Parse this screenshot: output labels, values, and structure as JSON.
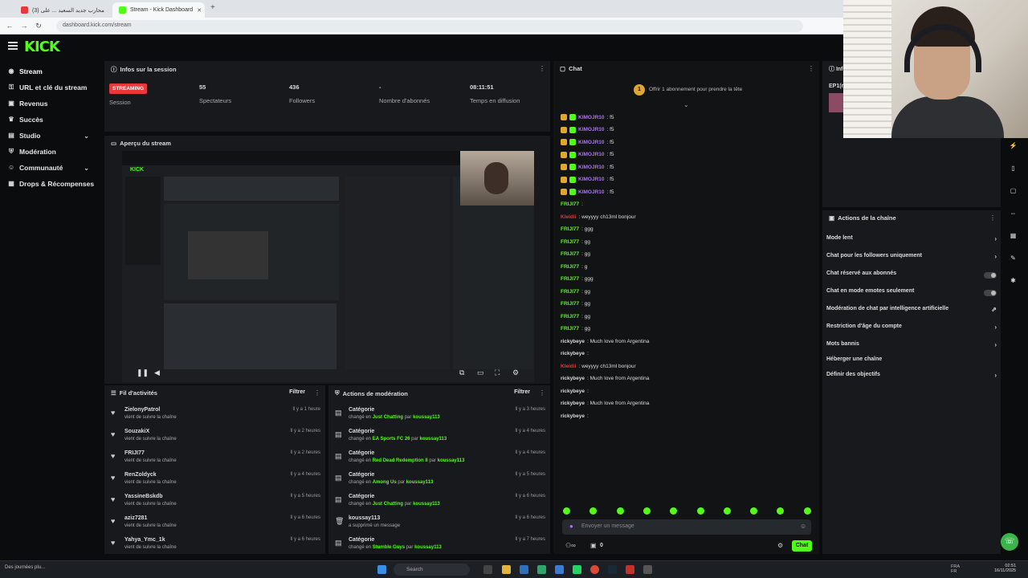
{
  "browser": {
    "tabs": [
      {
        "label": "(3) محارب جديد السعيد ... على",
        "active": false
      },
      {
        "label": "Stream - Kick Dashboard",
        "active": true
      }
    ],
    "new_tab": "+",
    "url": "dashboard.kick.com/stream"
  },
  "header": {
    "logo": "KICK"
  },
  "sidebar": {
    "items": [
      {
        "label": "Stream",
        "icon": "broadcast-icon",
        "chevron": false
      },
      {
        "label": "URL et clé du stream",
        "icon": "key-icon",
        "chevron": false
      },
      {
        "label": "Revenus",
        "icon": "money-icon",
        "chevron": false
      },
      {
        "label": "Succès",
        "icon": "trophy-icon",
        "chevron": false
      },
      {
        "label": "Studio",
        "icon": "studio-icon",
        "chevron": true
      },
      {
        "label": "Modération",
        "icon": "shield-icon",
        "chevron": false
      },
      {
        "label": "Communauté",
        "icon": "community-icon",
        "chevron": true
      },
      {
        "label": "Drops & Récompenses",
        "icon": "gift-icon",
        "chevron": false
      }
    ]
  },
  "session": {
    "title": "Infos sur la session",
    "stats": [
      {
        "value": "STREAMING",
        "label": "Session"
      },
      {
        "value": "55",
        "label": "Spectateurs"
      },
      {
        "value": "436",
        "label": "Followers"
      },
      {
        "value": "-",
        "label": "Nombre d'abonnés"
      },
      {
        "value": "08:11:51",
        "label": "Temps en diffusion"
      }
    ]
  },
  "preview": {
    "title": "Aperçu du stream"
  },
  "activity": {
    "title": "Fil d'activités",
    "filter": "Filtrer",
    "items": [
      {
        "name": "ZielonyPatrol",
        "sub": "vient de suivre la chaîne",
        "time": "Il y a 1 heure"
      },
      {
        "name": "SouzakiX",
        "sub": "vient de suivre la chaîne",
        "time": "Il y a 2 heures"
      },
      {
        "name": "FRIJI77",
        "sub": "vient de suivre la chaîne",
        "time": "Il y a 2 heures"
      },
      {
        "name": "RenZoldyck",
        "sub": "vient de suivre la chaîne",
        "time": "Il y a 4 heures"
      },
      {
        "name": "YassineBskdb",
        "sub": "vient de suivre la chaîne",
        "time": "Il y a 5 heures"
      },
      {
        "name": "aziz7281",
        "sub": "vient de suivre la chaîne",
        "time": "Il y a 6 heures"
      },
      {
        "name": "Yahya_Ymc_1k",
        "sub": "vient de suivre la chaîne",
        "time": "Il y a 6 heures"
      }
    ]
  },
  "moderation": {
    "title": "Actions de modération",
    "filter": "Filtrer",
    "items": [
      {
        "name": "Catégorie",
        "pre": "changé en",
        "value": "Just Chatting",
        "mid": "par",
        "by": "koussay113",
        "time": "Il y a 3 heures"
      },
      {
        "name": "Catégorie",
        "pre": "changé en",
        "value": "EA Sports FC 26",
        "mid": "par",
        "by": "koussay113",
        "time": "Il y a 4 heures"
      },
      {
        "name": "Catégorie",
        "pre": "changé en",
        "value": "Red Dead Redemption II",
        "mid": "par",
        "by": "koussay113",
        "time": "Il y a 4 heures"
      },
      {
        "name": "Catégorie",
        "pre": "changé en",
        "value": "Among Us",
        "mid": "par",
        "by": "koussay113",
        "time": "Il y a 5 heures"
      },
      {
        "name": "Catégorie",
        "pre": "changé en",
        "value": "Just Chatting",
        "mid": "par",
        "by": "koussay113",
        "time": "Il y a 6 heures"
      },
      {
        "name": "koussay113",
        "pre": "a supprimé un message",
        "value": "",
        "mid": "",
        "by": "",
        "time": "Il y a 6 heures"
      },
      {
        "name": "Catégorie",
        "pre": "changé en",
        "value": "Stumble Guys",
        "mid": "par",
        "by": "koussay113",
        "time": "Il y a 7 heures"
      }
    ]
  },
  "chat": {
    "title": "Chat",
    "pinned": "Offrir 1 abonnement pour prendre la tête",
    "messages": [
      {
        "user": "KIMOJR10",
        "text": ": f5",
        "color": "#b46bff"
      },
      {
        "user": "KIMOJR10",
        "text": ": f5",
        "color": "#b46bff"
      },
      {
        "user": "KIMOJR10",
        "text": ": f5",
        "color": "#b46bff"
      },
      {
        "user": "KIMOJR10",
        "text": ": f5",
        "color": "#b46bff"
      },
      {
        "user": "KIMOJR10",
        "text": ": f5",
        "color": "#b46bff"
      },
      {
        "user": "KIMOJR10",
        "text": ": f5",
        "color": "#b46bff"
      },
      {
        "user": "KIMOJR10",
        "text": ": f5",
        "color": "#b46bff"
      },
      {
        "user": "FRIJI77",
        "text": ":",
        "color": "#53fc18"
      },
      {
        "user": "Kleidii",
        "text": ": weyyyy ch13ml bonjour",
        "color": "#e5393b"
      },
      {
        "user": "FRIJI77",
        "text": ": ggg",
        "color": "#53fc18"
      },
      {
        "user": "FRIJI77",
        "text": ": gg",
        "color": "#53fc18"
      },
      {
        "user": "FRIJI77",
        "text": ": gg",
        "color": "#53fc18"
      },
      {
        "user": "FRIJI77",
        "text": ": g",
        "color": "#53fc18"
      },
      {
        "user": "FRIJI77",
        "text": ": ggg",
        "color": "#53fc18"
      },
      {
        "user": "FRIJI77",
        "text": ": gg",
        "color": "#53fc18"
      },
      {
        "user": "FRIJI77",
        "text": ": gg",
        "color": "#53fc18"
      },
      {
        "user": "FRIJI77",
        "text": ": gg",
        "color": "#53fc18"
      },
      {
        "user": "FRIJI77",
        "text": ": gg",
        "color": "#53fc18"
      },
      {
        "user": "rickybeye",
        "text": ": Much love from Argentina",
        "color": "#dddddd"
      },
      {
        "user": "rickybeye",
        "text": ": ",
        "color": "#dddddd"
      },
      {
        "user": "Kleidii",
        "text": ": weyyyy ch13ml bonjour",
        "color": "#e5393b"
      },
      {
        "user": "rickybeye",
        "text": ": Much love from Argentina",
        "color": "#dddddd"
      },
      {
        "user": "rickybeye",
        "text": ": ",
        "color": "#dddddd"
      },
      {
        "user": "rickybeye",
        "text": ": Much love from Argentina",
        "color": "#dddddd"
      },
      {
        "user": "rickybeye",
        "text": ": ",
        "color": "#dddddd"
      }
    ],
    "input_placeholder": "Envoyer un message",
    "send": "Chat",
    "counter": "0"
  },
  "channel_actions": {
    "title": "Actions de la chaîne",
    "side_label": "Infos",
    "side_user": "EP1(r",
    "items": [
      {
        "label": "Mode lent",
        "control": "arrow"
      },
      {
        "label": "Chat pour les followers uniquement",
        "control": "arrow"
      },
      {
        "label": "Chat réservé aux abonnés",
        "control": "toggle"
      },
      {
        "label": "Chat en mode emotes seulement",
        "control": "toggle"
      },
      {
        "label": "Modération de chat par intelligence artificielle",
        "control": "ext"
      },
      {
        "label": "Restriction d'âge du compte",
        "control": "arrow"
      },
      {
        "label": "Mots bannis",
        "control": "arrow"
      },
      {
        "label": "Héberger une chaîne",
        "control": "none"
      },
      {
        "label": "Définir des objectifs",
        "control": "arrow"
      }
    ]
  },
  "taskbar": {
    "search": "Search",
    "downloads": "Des journées plu...",
    "clock": "02:51",
    "date": "16/11/2025",
    "lang": "FRA\nFR"
  },
  "colors": {
    "accent": "#53fc18",
    "live": "#e5393b",
    "bg": "#0b0c0d",
    "panel": "#17191c"
  }
}
